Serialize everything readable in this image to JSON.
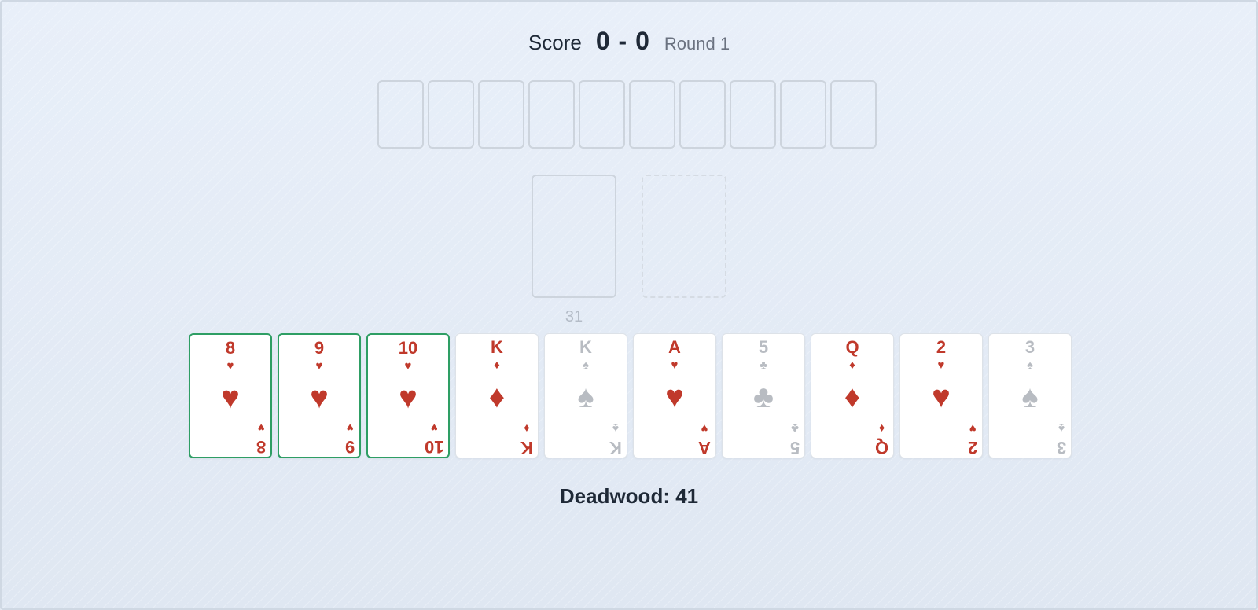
{
  "scorebar": {
    "score_label": "Score",
    "score_value": "0 - 0",
    "round_label": "Round 1"
  },
  "opponent_hand": {
    "card_count": 10
  },
  "stock": {
    "count": "31"
  },
  "discard": {
    "empty": true
  },
  "hand": [
    {
      "rank": "8",
      "suit": "♥",
      "suit_name": "hearts",
      "color": "red",
      "meld": true
    },
    {
      "rank": "9",
      "suit": "♥",
      "suit_name": "hearts",
      "color": "red",
      "meld": true
    },
    {
      "rank": "10",
      "suit": "♥",
      "suit_name": "hearts",
      "color": "red",
      "meld": true
    },
    {
      "rank": "K",
      "suit": "♦",
      "suit_name": "diamonds",
      "color": "red",
      "meld": false
    },
    {
      "rank": "K",
      "suit": "♠",
      "suit_name": "spades",
      "color": "grey",
      "meld": false
    },
    {
      "rank": "A",
      "suit": "♥",
      "suit_name": "hearts",
      "color": "red",
      "meld": false
    },
    {
      "rank": "5",
      "suit": "♣",
      "suit_name": "clubs",
      "color": "grey",
      "meld": false
    },
    {
      "rank": "Q",
      "suit": "♦",
      "suit_name": "diamonds",
      "color": "red",
      "meld": false
    },
    {
      "rank": "2",
      "suit": "♥",
      "suit_name": "hearts",
      "color": "red",
      "meld": false
    },
    {
      "rank": "3",
      "suit": "♠",
      "suit_name": "spades",
      "color": "grey",
      "meld": false
    }
  ],
  "deadwood": {
    "label": "Deadwood: 41"
  },
  "colors": {
    "red_suit": "#c0392b",
    "dark_suit": "#b8bcc2",
    "meld_border": "#2e9e64"
  }
}
